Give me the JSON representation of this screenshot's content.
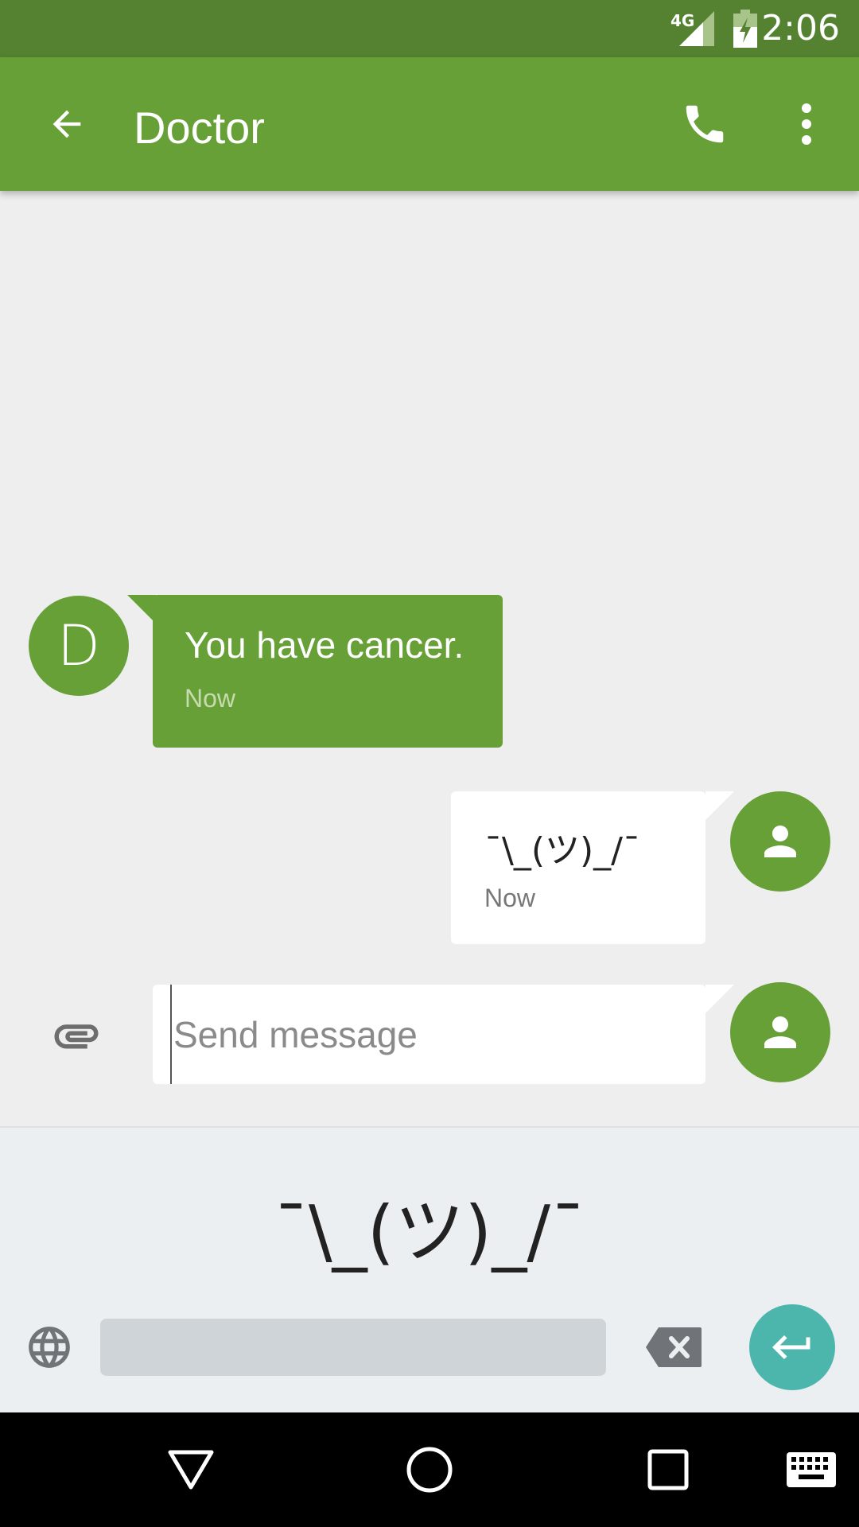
{
  "status_bar": {
    "network": "4G",
    "time": "2:06"
  },
  "app_bar": {
    "title": "Doctor"
  },
  "messages": [
    {
      "direction": "incoming",
      "avatar_letter": "D",
      "text": "You have cancer.",
      "time": "Now"
    },
    {
      "direction": "outgoing",
      "text": "¯\\_(ツ)_/¯",
      "time": "Now"
    }
  ],
  "compose": {
    "placeholder": "Send message",
    "value": ""
  },
  "keyboard": {
    "suggestion": "¯\\_(ツ)_/¯"
  },
  "colors": {
    "primary": "#68a038",
    "primary_dark": "#548230",
    "accent": "#4db6ac",
    "background": "#eeeeee"
  },
  "icons": [
    "back-arrow-icon",
    "phone-icon",
    "more-vert-icon",
    "paperclip-icon",
    "person-icon",
    "globe-icon",
    "backspace-icon",
    "enter-icon",
    "back-nav-icon",
    "home-nav-icon",
    "recents-nav-icon",
    "keyboard-icon"
  ]
}
